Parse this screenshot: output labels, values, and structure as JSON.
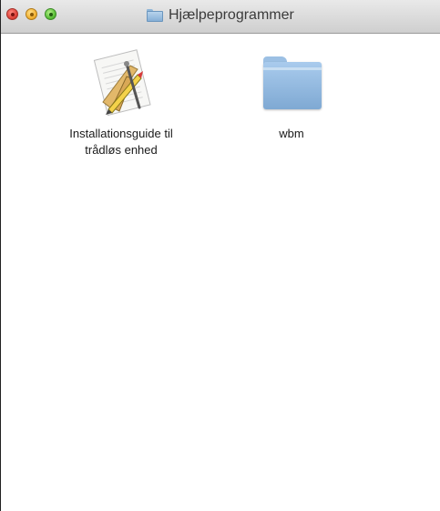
{
  "window": {
    "title": "Hjælpeprogrammer"
  },
  "items": [
    {
      "label_line1": "Installationsguide til",
      "label_line2": "trådløs enhed",
      "icon": "installer-app-icon"
    },
    {
      "label_line1": "wbm",
      "icon": "folder-icon"
    }
  ],
  "colors": {
    "folder": "#8fb6d8",
    "close": "#e0443a",
    "minimize": "#f2b233",
    "zoom": "#5cc23a"
  }
}
